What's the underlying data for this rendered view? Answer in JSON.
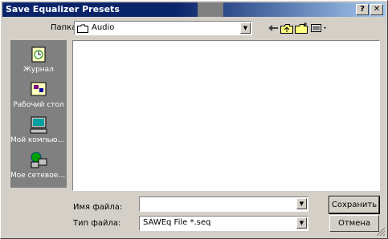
{
  "window": {
    "title": "Save Equalizer Presets"
  },
  "titlebar": {
    "help_label": "?",
    "close_label": "✕"
  },
  "location": {
    "label": "Папка:",
    "value": "Audio"
  },
  "toolbar": {
    "icons": [
      "back-icon",
      "up-folder-icon",
      "new-folder-icon",
      "view-menu-icon"
    ]
  },
  "places": [
    {
      "label": "Журнал",
      "icon": "history-icon"
    },
    {
      "label": "Рабочий стол",
      "icon": "desktop-icon"
    },
    {
      "label": "Мой компьютер",
      "icon": "my-computer-icon"
    },
    {
      "label": "Мое сетевое окружение",
      "icon": "network-places-icon"
    }
  ],
  "filename": {
    "label": "Имя файла:",
    "value": ""
  },
  "filetype": {
    "label": "Тип файла:",
    "value": "SAWEq File *.seq"
  },
  "buttons": {
    "save": "Сохранить",
    "cancel": "Отмена"
  },
  "colors": {
    "title_active": "#0a246a",
    "face": "#d4d0c8",
    "places_bg": "#808080"
  }
}
